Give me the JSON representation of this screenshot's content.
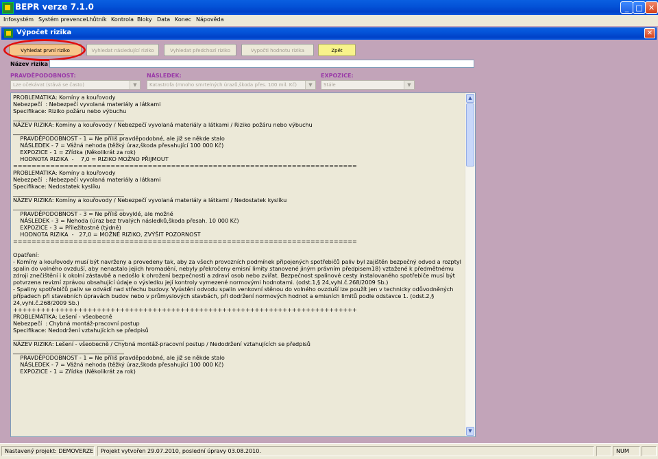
{
  "window": {
    "title": "BEPR verze 7.1.0",
    "minimize": "_",
    "maximize": "□",
    "close": "✕"
  },
  "menu": [
    "Infosystém",
    "Systém prevence",
    "Lhůtník",
    "Kontrola",
    "Bloky",
    "Data",
    "Konec",
    "Nápověda"
  ],
  "dialog": {
    "title": "Výpočet rizika",
    "close": "✕"
  },
  "buttons": {
    "find_first": "Vyhledat první riziko",
    "find_next": "Vyhledat následující riziko",
    "find_prev": "Vyhledat předchozí riziko",
    "calc": "Vypočti hodnotu rizika",
    "back": "Zpět"
  },
  "risk_name": {
    "label": "Název rizika",
    "value": ""
  },
  "probability": {
    "label": "PRAVDĚPODOBNOST:",
    "value": "Lze očekávat (stává se často)"
  },
  "consequence": {
    "label": "NÁSLEDEK:",
    "value": "Katastrofa (mnoho smrtelných úrazů,škoda přes. 100 mil. Kč)"
  },
  "exposure": {
    "label": "EXPOZICE:",
    "value": "Stále"
  },
  "report_text": "PROBLEMATIKA: Komíny a kouřovody\nNebezpečí  : Nebezpečí vyvolaná materiály a látkami\nSpecifikace: Riziko požáru nebo výbuchu\n________________________________________\nNÁZEV RIZIKA: Komíny a kouřovody / Nebezpečí vyvolaná materiály a látkami / Riziko požáru nebo výbuchu\n________________________________________\n    PRAVDĚPODOBNOST - 1 = Ne příliš pravděpodobné, ale již se někde stalo\n    NÁSLEDEK - 7 = Vážná nehoda (těžký úraz,škoda přesahující 100 000 Kč)\n    EXPOZICE - 1 = Zřídka (Několikrát za rok)\n    HODNOTA RIZIKA  -    7,0 = RIZIKO MOŽNO PŘIJMOUT\n==========================================================================\nPROBLEMATIKA: Komíny a kouřovody\nNebezpečí  : Nebezpečí vyvolaná materiály a látkami\nSpecifikace: Nedostatek kyslíku\n________________________________________\nNÁZEV RIZIKA: Komíny a kouřovody / Nebezpečí vyvolaná materiály a látkami / Nedostatek kyslíku\n________________________________________\n    PRAVDĚPODOBNOST - 3 = Ne příliš obvyklé, ale možné\n    NÁSLEDEK - 3 = Nehoda (úraz bez trvalých následků,škoda přesah. 10 000 Kč)\n    EXPOZICE - 3 = Příležitostně (týdně)\n    HODNOTA RIZIKA  -   27,0 = MOŽNÉ RIZIKO, ZVÝŠIT POZORNOST\n==========================================================================\n\nOpatření:\n- Komíny a kouřovody musí být navrženy a provedeny tak, aby za všech provozních podmínek připojených spotřebičů paliv byl zajištěn bezpečný odvod a rozptyl spalin do volného ovzduší, aby nenastalo jejich hromadění, nebyly překročeny emisní limity stanovené jiným právním předpisem18) vztažené k předmětnému zdroji znečištění i k okolní zástavbě a nedošlo k ohrožení bezpečnosti a zdraví osob nebo zvířat. Bezpečnost spalinové cesty instalovaného spotřebiče musí být potvrzena revizní zprávou obsahující údaje o výsledku její kontroly vymezené normovými hodnotami. (odst.1,§ 24,vyhl.č.268/2009 Sb.)\n- Spaliny spotřebičů paliv se odvádí nad střechu budovy. Vyústění odvodu spalin venkovní stěnou do volného ovzduší lze použít jen v technicky odůvodněných případech při stavebních úpravách budov nebo v průmyslových stavbách, při dodržení normových hodnot a emisních limitů podle odstavce 1. (odst.2,§ 24,vyhl.č.268/2009 Sb.)\n++++++++++++++++++++++++++++++++++++++++++++++++++++++++++++++++++++++++++\nPROBLEMATIKA: Lešení - všeobecně\nNebezpečí  : Chybná montáž-pracovní postup\nSpecifikace: Nedodržení vztahujících se předpisů\n________________________________________\nNÁZEV RIZIKA: Lešení - všeobecně / Chybná montáž-pracovní postup / Nedodržení vztahujících se předpisů\n________________________________________\n    PRAVDĚPODOBNOST - 1 = Ne příliš pravděpodobné, ale již se někde stalo\n    NÁSLEDEK - 7 = Vážná nehoda (těžký úraz,škoda přesahující 100 000 Kč)\n    EXPOZICE - 1 = Zřídka (Několikrát za rok)",
  "status": {
    "project": "Nastavený projekt: DEMOVERZE",
    "created": "Projekt vytvořen 29.07.2010, poslední úpravy 03.08.2010.",
    "num": "NUM"
  }
}
